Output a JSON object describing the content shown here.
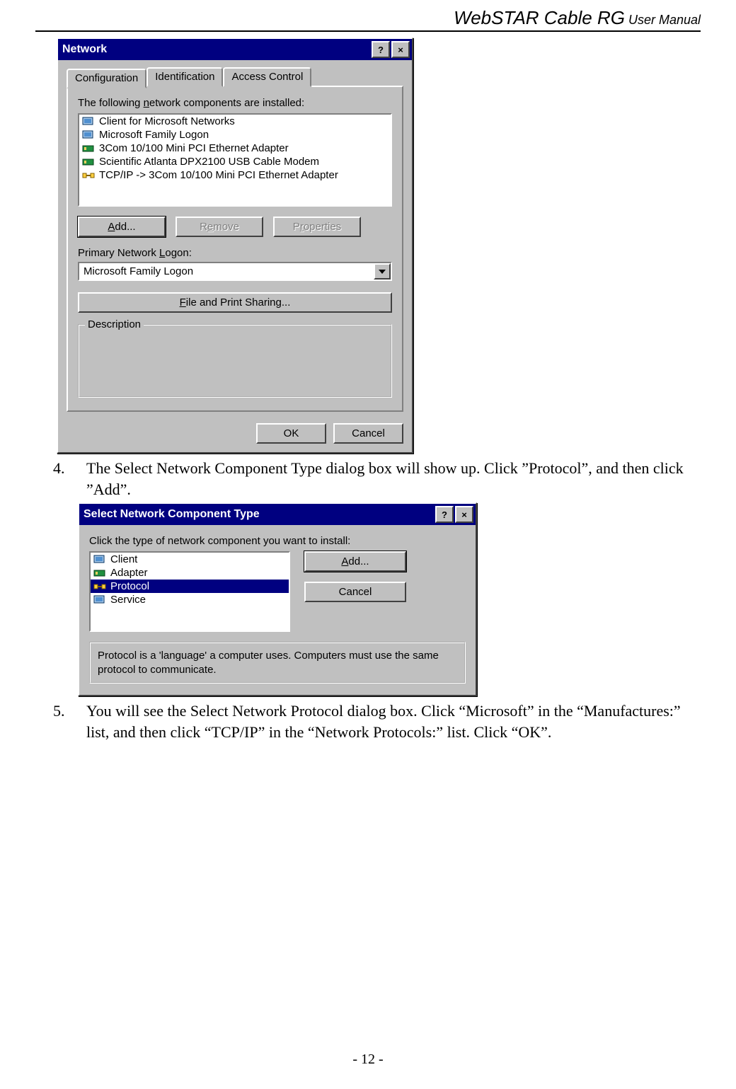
{
  "header": {
    "brand": "WebSTAR Cable RG",
    "suffix": " User Manual"
  },
  "footer": {
    "page": "- 12 -"
  },
  "steps": {
    "s4": {
      "num": "4.",
      "text": "The Select Network Component Type dialog box will show up. Click ”Protocol”, and then click ”Add”."
    },
    "s5": {
      "num": "5.",
      "text": "You will see the Select Network Protocol dialog box. Click “Microsoft” in the “Manufactures:” list, and then click “TCP/IP” in the “Network Protocols:” list. Click “OK”."
    }
  },
  "dlg1": {
    "title": "Network",
    "help": "?",
    "close": "×",
    "tabs": {
      "t1": "Configuration",
      "t2": "Identification",
      "t3": "Access Control"
    },
    "installed_label_pre": "The following ",
    "installed_label_u": "n",
    "installed_label_post": "etwork components are installed:",
    "items": {
      "i1": "Client for Microsoft Networks",
      "i2": "Microsoft Family Logon",
      "i3": "3Com 10/100 Mini PCI Ethernet Adapter",
      "i4": "Scientific Atlanta DPX2100 USB Cable Modem",
      "i5": "TCP/IP -> 3Com 10/100 Mini PCI Ethernet Adapter"
    },
    "add_u": "A",
    "add_rest": "dd...",
    "remove_pre": "R",
    "remove_u": "e",
    "remove_post": "move",
    "props_pre": "P",
    "props_u": "r",
    "props_post": "operties",
    "logon_pre": "Primary Network ",
    "logon_u": "L",
    "logon_post": "ogon:",
    "logon_value": "Microsoft Family Logon",
    "share_u": "F",
    "share_rest": "ile and Print Sharing...",
    "desc": "Description",
    "ok": "OK",
    "cancel": "Cancel"
  },
  "dlg2": {
    "title": "Select Network Component Type",
    "help": "?",
    "close": "×",
    "prompt": "Click the type of network component you want to install:",
    "items": {
      "i1": "Client",
      "i2": "Adapter",
      "i3": "Protocol",
      "i4": "Service"
    },
    "add_u": "A",
    "add_rest": "dd...",
    "cancel": "Cancel",
    "desc": "Protocol is a 'language' a computer uses. Computers must use the same protocol to communicate."
  }
}
